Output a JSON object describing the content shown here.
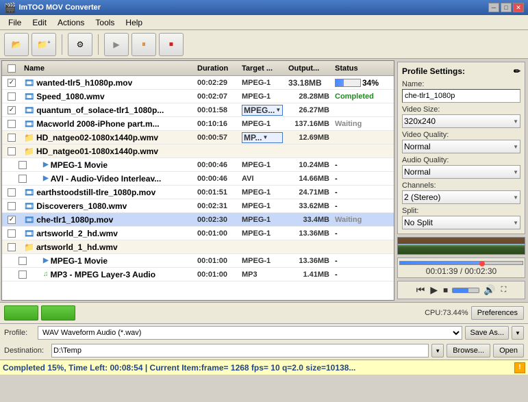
{
  "app": {
    "title": "ImTOO MOV Converter",
    "icon": "🎬"
  },
  "title_buttons": {
    "minimize": "─",
    "maximize": "□",
    "close": "✕"
  },
  "menu": {
    "items": [
      "File",
      "Edit",
      "Actions",
      "Tools",
      "Help"
    ]
  },
  "toolbar": {
    "buttons": [
      {
        "name": "add-file",
        "icon": "📂",
        "label": "Add"
      },
      {
        "name": "add-folder",
        "icon": "📁",
        "label": "Add Folder"
      },
      {
        "name": "options",
        "icon": "⚙",
        "label": "Options"
      },
      {
        "name": "play",
        "icon": "▶",
        "label": "Play"
      },
      {
        "name": "pause",
        "icon": "⏸",
        "label": "Pause"
      },
      {
        "name": "stop",
        "icon": "⏹",
        "label": "Stop"
      }
    ]
  },
  "file_list": {
    "columns": [
      "",
      "Name",
      "Duration",
      "Target ...",
      "Output...",
      "Status"
    ],
    "rows": [
      {
        "checked": true,
        "icon": "film",
        "name": "wanted-tlr5_h1080p.mov",
        "duration": "00:02:29",
        "target": "MPEG-1",
        "output": "33.18MB",
        "status": "34%",
        "has_progress": true,
        "progress": 34,
        "indent": 0
      },
      {
        "checked": false,
        "icon": "film",
        "name": "Speed_1080.wmv",
        "duration": "00:02:07",
        "target": "MPEG-1",
        "output": "28.28MB",
        "status": "Completed",
        "has_progress": false,
        "indent": 0
      },
      {
        "checked": true,
        "icon": "film",
        "name": "quantum_of_solace-tlr1_1080p...",
        "duration": "00:01:58",
        "target": "MPEG...",
        "output": "26.27MB",
        "status": "",
        "has_progress": false,
        "indent": 0,
        "target_dropdown": true
      },
      {
        "checked": false,
        "icon": "film",
        "name": "Macworld 2008-iPhone part.m...",
        "duration": "00:10:16",
        "target": "MPEG-1",
        "output": "137.16MB",
        "status": "Waiting",
        "has_progress": false,
        "indent": 0
      },
      {
        "checked": false,
        "icon": "folder",
        "name": "HD_natgeo02-1080x1440p.wmv",
        "duration": "00:00:57",
        "target": "MP...",
        "output": "12.69MB",
        "status": "",
        "has_progress": false,
        "indent": 0,
        "target_dropdown": true,
        "is_folder": true
      },
      {
        "checked": false,
        "icon": "folder",
        "name": "HD_natgeo01-1080x1440p.wmv",
        "duration": "",
        "target": "",
        "output": "",
        "status": "",
        "has_progress": false,
        "indent": 0,
        "is_folder": true
      },
      {
        "checked": false,
        "icon": "sub",
        "name": "MPEG-1 Movie",
        "duration": "00:00:46",
        "target": "MPEG-1",
        "output": "10.24MB",
        "status": "-",
        "has_progress": false,
        "indent": 1
      },
      {
        "checked": false,
        "icon": "sub",
        "name": "AVI - Audio-Video Interleav...",
        "duration": "00:00:46",
        "target": "AVI",
        "output": "14.66MB",
        "status": "-",
        "has_progress": false,
        "indent": 1
      },
      {
        "checked": false,
        "icon": "film",
        "name": "earthstoodstill-tlre_1080p.mov",
        "duration": "00:01:51",
        "target": "MPEG-1",
        "output": "24.71MB",
        "status": "-",
        "has_progress": false,
        "indent": 0
      },
      {
        "checked": false,
        "icon": "film",
        "name": "Discoverers_1080.wmv",
        "duration": "00:02:31",
        "target": "MPEG-1",
        "output": "33.62MB",
        "status": "-",
        "has_progress": false,
        "indent": 0
      },
      {
        "checked": true,
        "icon": "film",
        "name": "che-tlr1_1080p.mov",
        "duration": "00:02:30",
        "target": "MPEG-1",
        "output": "33.4MB",
        "status": "Waiting",
        "has_progress": false,
        "indent": 0
      },
      {
        "checked": false,
        "icon": "film",
        "name": "artsworld_2_hd.wmv",
        "duration": "00:01:00",
        "target": "MPEG-1",
        "output": "13.36MB",
        "status": "-",
        "has_progress": false,
        "indent": 0
      },
      {
        "checked": false,
        "icon": "folder",
        "name": "artsworld_1_hd.wmv",
        "duration": "",
        "target": "",
        "output": "",
        "status": "",
        "has_progress": false,
        "indent": 0,
        "is_folder": true
      },
      {
        "checked": false,
        "icon": "sub",
        "name": "MPEG-1 Movie",
        "duration": "00:01:00",
        "target": "MPEG-1",
        "output": "13.36MB",
        "status": "-",
        "has_progress": false,
        "indent": 1
      },
      {
        "checked": false,
        "icon": "sub-audio",
        "name": "MP3 - MPEG Layer-3 Audio",
        "duration": "00:01:00",
        "target": "MP3",
        "output": "1.41MB",
        "status": "-",
        "has_progress": false,
        "indent": 1
      }
    ]
  },
  "profile_settings": {
    "title": "Profile Settings:",
    "edit_icon": "✏",
    "name_label": "Name:",
    "name_value": "che-tlr1_1080p",
    "video_size_label": "Video Size:",
    "video_size_value": "320x240",
    "video_quality_label": "Video Quality:",
    "video_quality_value": "Normal",
    "audio_quality_label": "Audio Quality:",
    "audio_quality_value": "Normal",
    "channels_label": "Channels:",
    "channels_value": "2 (Stereo)",
    "split_label": "Split:",
    "split_value": "No Split"
  },
  "preview": {
    "time_current": "00:01:39",
    "time_total": "00:02:30",
    "time_display": "00:01:39 / 00:02:30"
  },
  "playback": {
    "play_icon": "▶",
    "prev_icon": "⏮",
    "stop_icon": "⏹",
    "vol_icon": "🔊",
    "fullscreen_icon": "⛶"
  },
  "bottom_toolbar": {
    "cpu_text": "CPU:73.44%",
    "preferences_label": "Preferences"
  },
  "profile_row": {
    "label": "Profile:",
    "value": "WAV Waveform Audio (*.wav)",
    "save_as_label": "Save As...",
    "arrow": "▼"
  },
  "destination_row": {
    "label": "Destination:",
    "value": "D:\\Temp",
    "browse_label": "Browse...",
    "open_label": "Open"
  },
  "status_bar": {
    "text": "Completed 15%, Time Left: 00:08:54 | Current Item:frame= 1268 fps= 10 q=2.0 size=10138...",
    "warn": "!"
  }
}
